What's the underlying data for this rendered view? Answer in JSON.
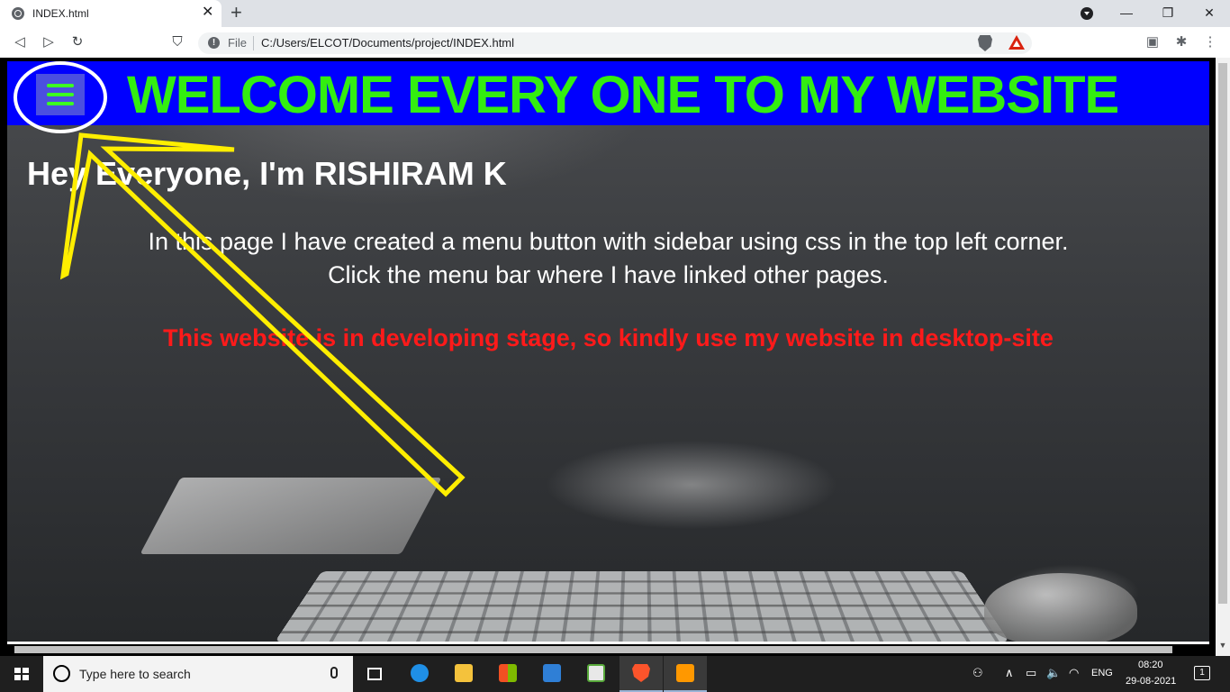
{
  "browser": {
    "tab_title": "INDEX.html",
    "tab_close": "✕",
    "new_tab": "+",
    "minimize": "—",
    "restore": "❐",
    "close": "✕",
    "back": "◁",
    "forward": "▷",
    "reload": "↻",
    "bookmark": "⛉",
    "site_info": "!",
    "file_label": "File",
    "url": "C:/Users/ELCOT/Documents/project/INDEX.html",
    "extensions_icon": "✱",
    "menu_icon": "⋮",
    "wallet_icon": "▣"
  },
  "page": {
    "title": "WELCOME EVERY ONE TO MY WEBSITE",
    "greeting": "Hey Everyone, I'm RISHIRAM K",
    "intro_line1": "In this page I have created a menu button with sidebar using css in the top left corner.",
    "intro_line2": "Click the menu bar where I have linked other pages.",
    "warning": "This website is in developing stage, so kindly use my website in desktop-site",
    "colors": {
      "header_bg": "#0000ff",
      "title": "#33ee10",
      "warning": "#ff1a1a",
      "annotation": "#ffee00"
    }
  },
  "scrollbar": {
    "down_arrow": "▼"
  },
  "taskbar": {
    "search_placeholder": "Type here to search",
    "apps": [
      "task-view",
      "edge",
      "file-explorer",
      "store",
      "mail",
      "app",
      "brave",
      "sublime-text"
    ],
    "tray_people": "⚇",
    "tray_chevron": "∧",
    "tray_battery": "▭",
    "tray_volume": "🔈",
    "tray_wifi": "◠",
    "language": "ENG",
    "time": "08:20",
    "date": "29-08-2021",
    "notification_count": "1"
  }
}
